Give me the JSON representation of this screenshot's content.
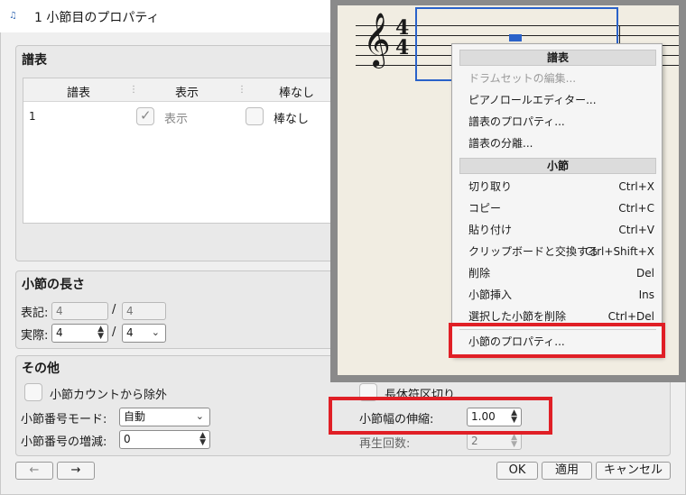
{
  "window": {
    "title": "1 小節目のプロパティ",
    "icon": "app-icon"
  },
  "staves": {
    "title": "譜表",
    "columns": [
      "譜表",
      "表示",
      "棒なし"
    ],
    "rows": [
      {
        "index": "1",
        "show_label": "表示",
        "show_checked": true,
        "nobar_label": "棒なし",
        "nobar_checked": false
      }
    ]
  },
  "measure_length": {
    "title": "小節の長さ",
    "notation_label": "表記:",
    "notation_num": "4",
    "notation_den": "4",
    "actual_label": "実際:",
    "actual_num": "4",
    "actual_den": "4",
    "slash": "/"
  },
  "other": {
    "title": "その他",
    "exclude_label": "小節カウントから除外",
    "break_label": "長休符区切り",
    "number_mode_label": "小節番号モード:",
    "number_mode_value": "自動",
    "number_offset_label": "小節番号の増減:",
    "number_offset_value": "0",
    "stretch_label": "小節幅の伸縮:",
    "stretch_value": "1.00",
    "repeat_label": "再生回数:",
    "repeat_value": "2"
  },
  "footer": {
    "prev": "←",
    "next": "→",
    "ok": "OK",
    "apply": "適用",
    "cancel": "キャンセル"
  },
  "context_menu": {
    "staff_header": "譜表",
    "staff_items": [
      {
        "label": "ドラムセットの編集...",
        "disabled": true
      },
      {
        "label": "ピアノロールエディター..."
      },
      {
        "label": "譜表のプロパティ..."
      },
      {
        "label": "譜表の分離..."
      }
    ],
    "measure_header": "小節",
    "measure_items": [
      {
        "label": "切り取り",
        "shortcut": "Ctrl+X"
      },
      {
        "label": "コピー",
        "shortcut": "Ctrl+C"
      },
      {
        "label": "貼り付け",
        "shortcut": "Ctrl+V"
      },
      {
        "label": "クリップボードと交換する",
        "shortcut": "Ctrl+Shift+X"
      },
      {
        "label": "削除",
        "shortcut": "Del"
      },
      {
        "label": "小節挿入",
        "shortcut": "Ins"
      },
      {
        "label": "選択した小節を削除",
        "shortcut": "Ctrl+Del"
      }
    ],
    "properties_item": "小節のプロパティ..."
  },
  "colors": {
    "highlight": "#e01f26",
    "selection": "#2a62c9"
  }
}
